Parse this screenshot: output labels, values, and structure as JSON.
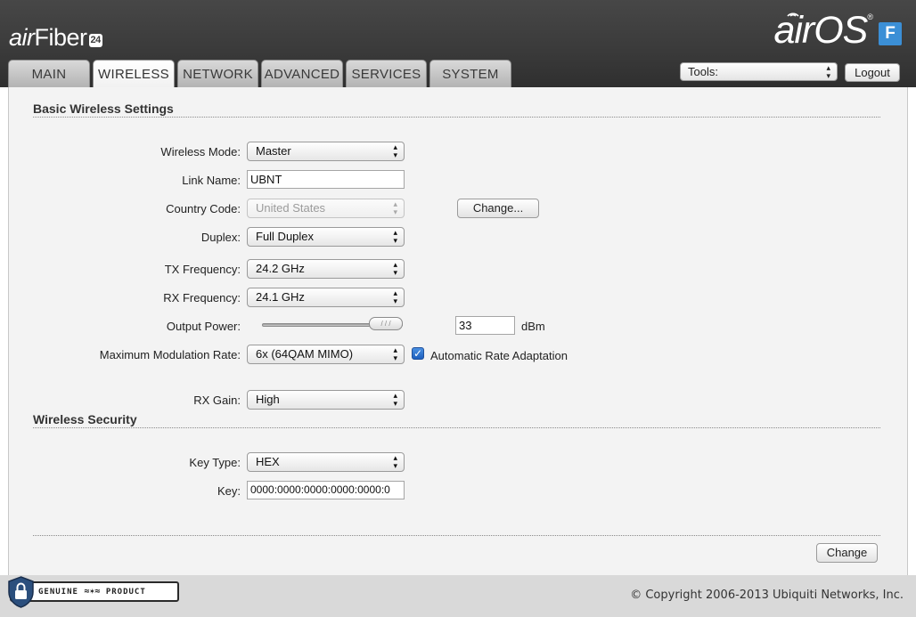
{
  "header": {
    "product_name_prefix": "air",
    "product_name_suffix": "Fiber",
    "product_badge": "24",
    "os_logo": "airOS",
    "os_badge": "F"
  },
  "tabs": [
    {
      "label": "MAIN",
      "active": false
    },
    {
      "label": "WIRELESS",
      "active": true
    },
    {
      "label": "NETWORK",
      "active": false
    },
    {
      "label": "ADVANCED",
      "active": false
    },
    {
      "label": "SERVICES",
      "active": false
    },
    {
      "label": "SYSTEM",
      "active": false
    }
  ],
  "tools": {
    "selected": "Tools:"
  },
  "logout_label": "Logout",
  "basic": {
    "title": "Basic Wireless Settings",
    "wireless_mode": {
      "label": "Wireless Mode:",
      "value": "Master"
    },
    "link_name": {
      "label": "Link Name:",
      "value": "UBNT"
    },
    "country_code": {
      "label": "Country Code:",
      "value": "United States",
      "change_label": "Change..."
    },
    "duplex": {
      "label": "Duplex:",
      "value": "Full Duplex"
    },
    "tx_frequency": {
      "label": "TX Frequency:",
      "value": "24.2 GHz"
    },
    "rx_frequency": {
      "label": "RX Frequency:",
      "value": "24.1 GHz"
    },
    "output_power": {
      "label": "Output Power:",
      "value": "33",
      "unit": "dBm"
    },
    "max_modulation": {
      "label": "Maximum Modulation Rate:",
      "value": "6x (64QAM MIMO)",
      "checkbox_label": "Automatic Rate Adaptation",
      "checked": true
    },
    "rx_gain": {
      "label": "RX Gain:",
      "value": "High"
    }
  },
  "security": {
    "title": "Wireless Security",
    "key_type": {
      "label": "Key Type:",
      "value": "HEX"
    },
    "key": {
      "label": "Key:",
      "value": "0000:0000:0000:0000:0000:0"
    }
  },
  "change_button": "Change",
  "footer": {
    "genuine_left": "GENUINE",
    "genuine_right": "PRODUCT",
    "copyright": "© Copyright 2006-2013 Ubiquiti Networks, Inc."
  },
  "colors": {
    "header_bg": "#3b3b3b",
    "content_bg": "#f3f3f3",
    "accent_blue": "#3b8fd6"
  }
}
